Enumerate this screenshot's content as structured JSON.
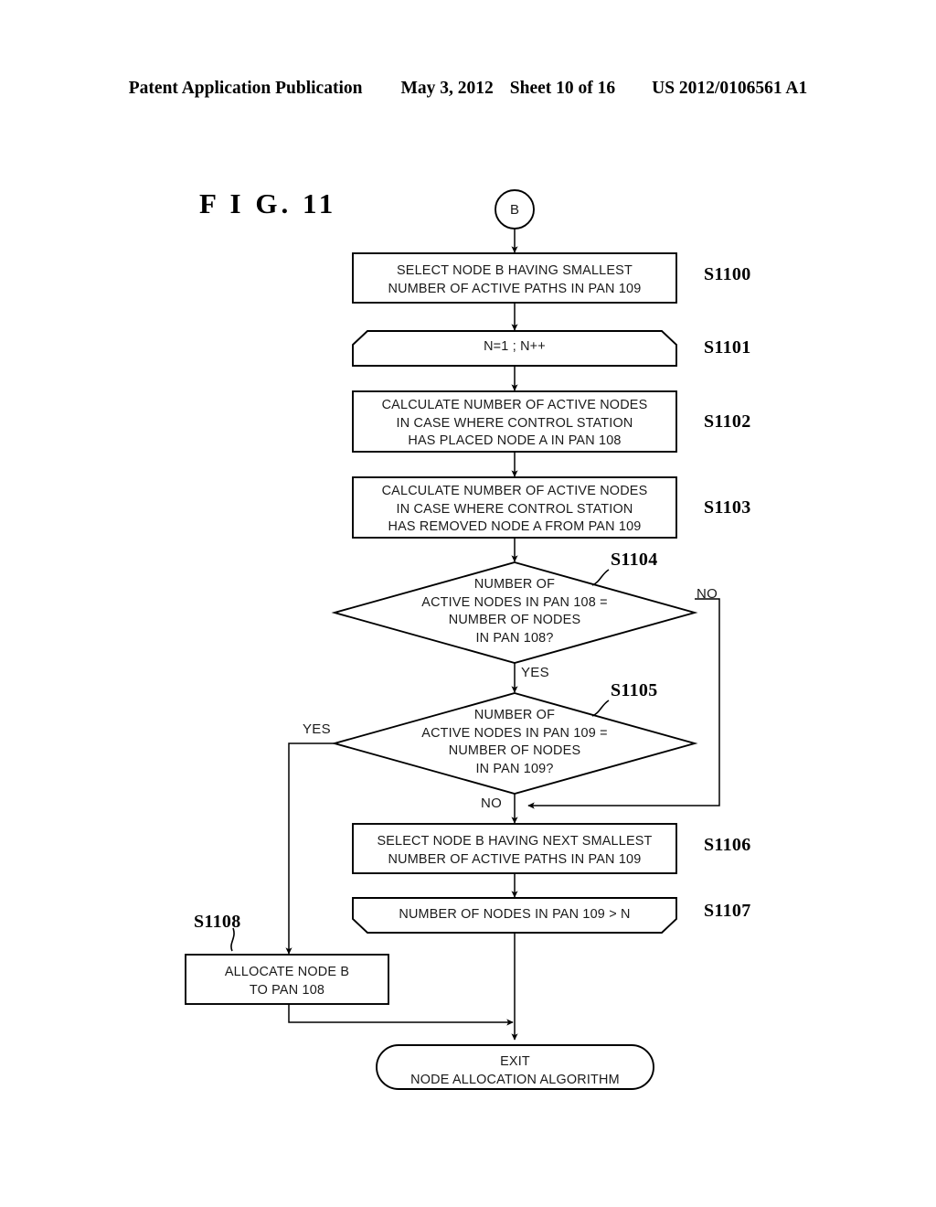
{
  "header": {
    "publication": "Patent Application Publication",
    "date": "May 3, 2012",
    "sheet": "Sheet 10 of 16",
    "patent_number": "US 2012/0106561 A1"
  },
  "figure": {
    "title": "F I G.  11"
  },
  "connector_in": {
    "label": "B"
  },
  "nodes": {
    "s1100": {
      "id": "S1100",
      "shape": "process",
      "line1": "SELECT NODE B HAVING SMALLEST",
      "line2": "NUMBER OF ACTIVE PATHS IN PAN 109"
    },
    "s1101": {
      "id": "S1101",
      "shape": "loop-start",
      "line1": "N=1 ; N++"
    },
    "s1102": {
      "id": "S1102",
      "shape": "process",
      "line1": "CALCULATE NUMBER OF ACTIVE NODES",
      "line2": "IN CASE WHERE CONTROL STATION",
      "line3": "HAS PLACED NODE A IN PAN 108"
    },
    "s1103": {
      "id": "S1103",
      "shape": "process",
      "line1": "CALCULATE NUMBER OF ACTIVE NODES",
      "line2": "IN CASE WHERE CONTROL STATION",
      "line3": "HAS REMOVED NODE A FROM PAN 109"
    },
    "s1104": {
      "id": "S1104",
      "shape": "decision",
      "line1": "NUMBER OF",
      "line2": "ACTIVE NODES IN PAN 108 =",
      "line3": "NUMBER OF NODES",
      "line4": "IN PAN 108?",
      "branch_yes": "YES",
      "branch_no": "NO"
    },
    "s1105": {
      "id": "S1105",
      "shape": "decision",
      "line1": "NUMBER OF",
      "line2": "ACTIVE NODES IN PAN 109 =",
      "line3": "NUMBER OF NODES",
      "line4": "IN PAN 109?",
      "branch_yes": "YES",
      "branch_no": "NO"
    },
    "s1106": {
      "id": "S1106",
      "shape": "process",
      "line1": "SELECT NODE B HAVING NEXT SMALLEST",
      "line2": "NUMBER OF ACTIVE PATHS IN PAN 109"
    },
    "s1107": {
      "id": "S1107",
      "shape": "loop-end",
      "line1": "NUMBER OF NODES IN PAN 109 > N"
    },
    "s1108": {
      "id": "S1108",
      "shape": "process",
      "line1": "ALLOCATE NODE B",
      "line2": "TO PAN 108"
    },
    "exit": {
      "shape": "terminator",
      "line1": "EXIT",
      "line2": "NODE ALLOCATION ALGORITHM"
    }
  }
}
